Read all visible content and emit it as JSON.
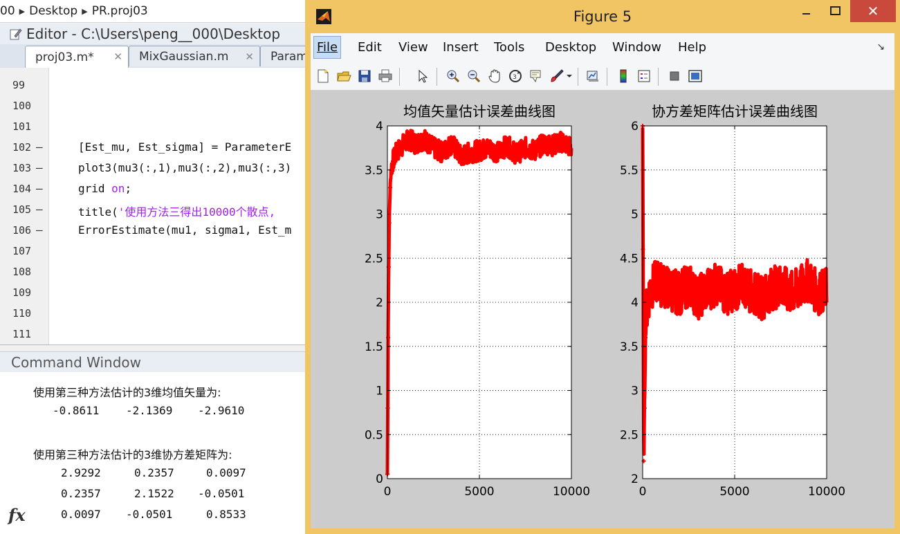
{
  "breadcrumb": {
    "items": [
      "00",
      "Desktop",
      "PR.proj03"
    ]
  },
  "editor": {
    "title": "Editor - C:\\Users\\peng__000\\Desktop",
    "tabs": [
      {
        "label": "proj03.m*",
        "active": true
      },
      {
        "label": "MixGaussian.m",
        "active": false
      },
      {
        "label": "Param",
        "active": false
      }
    ],
    "lines": [
      {
        "num": "99",
        "dash": "",
        "text": ""
      },
      {
        "num": "100",
        "dash": "",
        "text": ""
      },
      {
        "num": "101",
        "dash": "",
        "text": ""
      },
      {
        "num": "102",
        "dash": "–",
        "text": "[Est_mu, Est_sigma] = ParameterE"
      },
      {
        "num": "103",
        "dash": "–",
        "text": "plot3(mu3(:,1),mu3(:,2),mu3(:,3)"
      },
      {
        "num": "104",
        "dash": "–",
        "text_a": "grid ",
        "text_kw": "on",
        "text_b": ";"
      },
      {
        "num": "105",
        "dash": "–",
        "text_a": "title(",
        "text_kw": "'使用方法三得出10000个散点,",
        "text_b": ""
      },
      {
        "num": "106",
        "dash": "–",
        "text": "ErrorEstimate(mu1, sigma1, Est_m"
      },
      {
        "num": "107",
        "dash": "",
        "text": ""
      },
      {
        "num": "108",
        "dash": "",
        "text": ""
      },
      {
        "num": "109",
        "dash": "",
        "text": ""
      },
      {
        "num": "110",
        "dash": "",
        "text": ""
      },
      {
        "num": "111",
        "dash": "",
        "text": ""
      }
    ]
  },
  "command_window": {
    "title": "Command Window",
    "mean_heading": "使用第三种方法估计的3维均值矢量为:",
    "mean_values": [
      "-0.8611",
      "-2.1369",
      "-2.9610"
    ],
    "cov_heading": "使用第三种方法估计的3维协方差矩阵为:",
    "cov_rows": [
      [
        "2.9292",
        "0.2357",
        "0.0097"
      ],
      [
        "0.2357",
        "2.1522",
        "-0.0501"
      ],
      [
        "0.0097",
        "-0.0501",
        "0.8533"
      ]
    ],
    "prompt_icon": "fx"
  },
  "figure": {
    "title": "Figure 5",
    "close_glyph": "✕",
    "menus": [
      "File",
      "Edit",
      "View",
      "Insert",
      "Tools",
      "Desktop",
      "Window",
      "Help"
    ],
    "toolbar_icons": [
      "new-figure-icon",
      "open-file-icon",
      "save-icon",
      "print-icon",
      "pointer-icon",
      "zoom-in-icon",
      "zoom-out-icon",
      "pan-icon",
      "rotate-3d-icon",
      "data-cursor-icon",
      "brush-icon",
      "link-plot-icon",
      "colorbar-icon",
      "legend-icon",
      "hide-plot-tools-icon",
      "show-plot-tools-icon"
    ]
  },
  "chart_data": [
    {
      "type": "line",
      "title": "均值矢量估计误差曲线图",
      "xlim": [
        0,
        10000
      ],
      "ylim": [
        0,
        4
      ],
      "xticks": [
        "0",
        "5000",
        "10000"
      ],
      "yticks": [
        "0",
        "0.5",
        "1",
        "1.5",
        "2",
        "2.5",
        "3",
        "3.5",
        "4"
      ],
      "grid": true,
      "color": "#ff0000",
      "marker": "star",
      "series": [
        {
          "x": [
            0,
            20,
            40,
            70,
            100,
            150,
            200,
            300,
            400,
            500,
            700,
            900,
            1200,
            1500,
            2000,
            2500,
            3000,
            3500,
            4000,
            4500,
            5000,
            5500,
            6000,
            6500,
            7000,
            7500,
            8000,
            8500,
            9000,
            9500,
            10000
          ],
          "y": [
            0.05,
            0.8,
            1.6,
            2.4,
            2.9,
            3.3,
            3.5,
            3.6,
            3.65,
            3.7,
            3.75,
            3.8,
            3.85,
            3.8,
            3.85,
            3.75,
            3.7,
            3.8,
            3.65,
            3.7,
            3.72,
            3.75,
            3.7,
            3.78,
            3.68,
            3.75,
            3.72,
            3.8,
            3.78,
            3.82,
            3.75
          ],
          "band": 0.12
        }
      ]
    },
    {
      "type": "line",
      "title": "协方差矩阵估计误差曲线图",
      "xlim": [
        0,
        10000
      ],
      "ylim": [
        2,
        6
      ],
      "xticks": [
        "0",
        "5000",
        "10000"
      ],
      "yticks": [
        "2",
        "2.5",
        "3",
        "3.5",
        "4",
        "4.5",
        "5",
        "5.5",
        "6"
      ],
      "grid": true,
      "color": "#ff0000",
      "marker": "star",
      "series": [
        {
          "x": [
            0,
            10,
            20,
            40,
            60,
            100,
            150,
            200,
            300,
            400,
            600,
            800,
            1000,
            1500,
            2000,
            2500,
            3000,
            3500,
            4000,
            4500,
            5000,
            5500,
            6000,
            6500,
            7000,
            7500,
            8000,
            8500,
            9000,
            9500,
            10000
          ],
          "y": [
            6.0,
            5.5,
            4.6,
            3.5,
            2.2,
            2.8,
            3.6,
            3.9,
            4.0,
            4.15,
            4.2,
            4.25,
            4.2,
            4.15,
            4.1,
            4.2,
            4.05,
            4.15,
            4.2,
            4.1,
            4.15,
            4.2,
            4.1,
            4.05,
            4.15,
            4.2,
            4.1,
            4.15,
            4.25,
            4.1,
            4.15
          ],
          "band": 0.25
        }
      ]
    }
  ]
}
